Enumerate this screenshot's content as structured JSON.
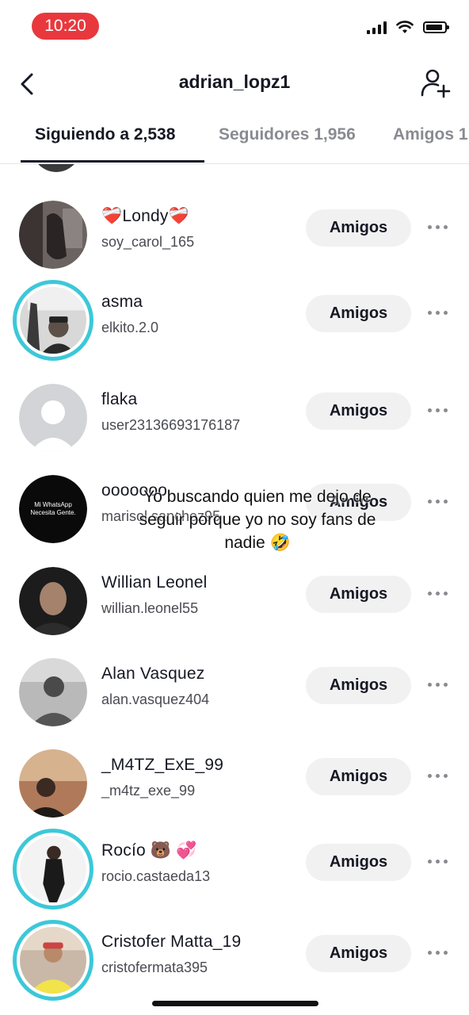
{
  "status_bar": {
    "time": "10:20"
  },
  "header": {
    "title": "adrian_lopz1"
  },
  "tabs": [
    {
      "label": "Siguiendo a 2,538",
      "active": true
    },
    {
      "label": "Seguidores 1,956",
      "active": false
    },
    {
      "label": "Amigos 1",
      "active": false
    }
  ],
  "rows": [
    {
      "name": "❤️‍🩹Londy❤️‍🩹",
      "username": "soy_carol_165",
      "button": "Amigos",
      "story_ring": false
    },
    {
      "name": "asma",
      "username": "elkito.2.0",
      "button": "Amigos",
      "story_ring": true
    },
    {
      "name": "flaka",
      "username": "user23136693176187",
      "button": "Amigos",
      "story_ring": false
    },
    {
      "name": "ooooooo",
      "username": "marisol.sanchez95",
      "button": "Amigos",
      "story_ring": false,
      "avatar_text": "Mi WhatsApp Necesita Gente."
    },
    {
      "name": "Willian Leonel",
      "username": "willian.leonel55",
      "button": "Amigos",
      "story_ring": false
    },
    {
      "name": "Alan Vasquez",
      "username": "alan.vasquez404",
      "button": "Amigos",
      "story_ring": false
    },
    {
      "name": "_M4TZ_ExE_99",
      "username": "_m4tz_exe_99",
      "button": "Amigos",
      "story_ring": false
    },
    {
      "name": "Rocío 🐻 💞",
      "username": "rocio.castaeda13",
      "button": "Amigos",
      "story_ring": true
    },
    {
      "name": "Cristofer Matta_19",
      "username": "cristofermata395",
      "button": "Amigos",
      "story_ring": true
    }
  ],
  "caption": "Yo buscando quien me dejo de seguir porque yo no soy fans de nadie 🤣",
  "colors": {
    "story_ring": "#3cc8d8",
    "time_pill": "#e8383d",
    "button_bg": "#f1f1f2"
  }
}
